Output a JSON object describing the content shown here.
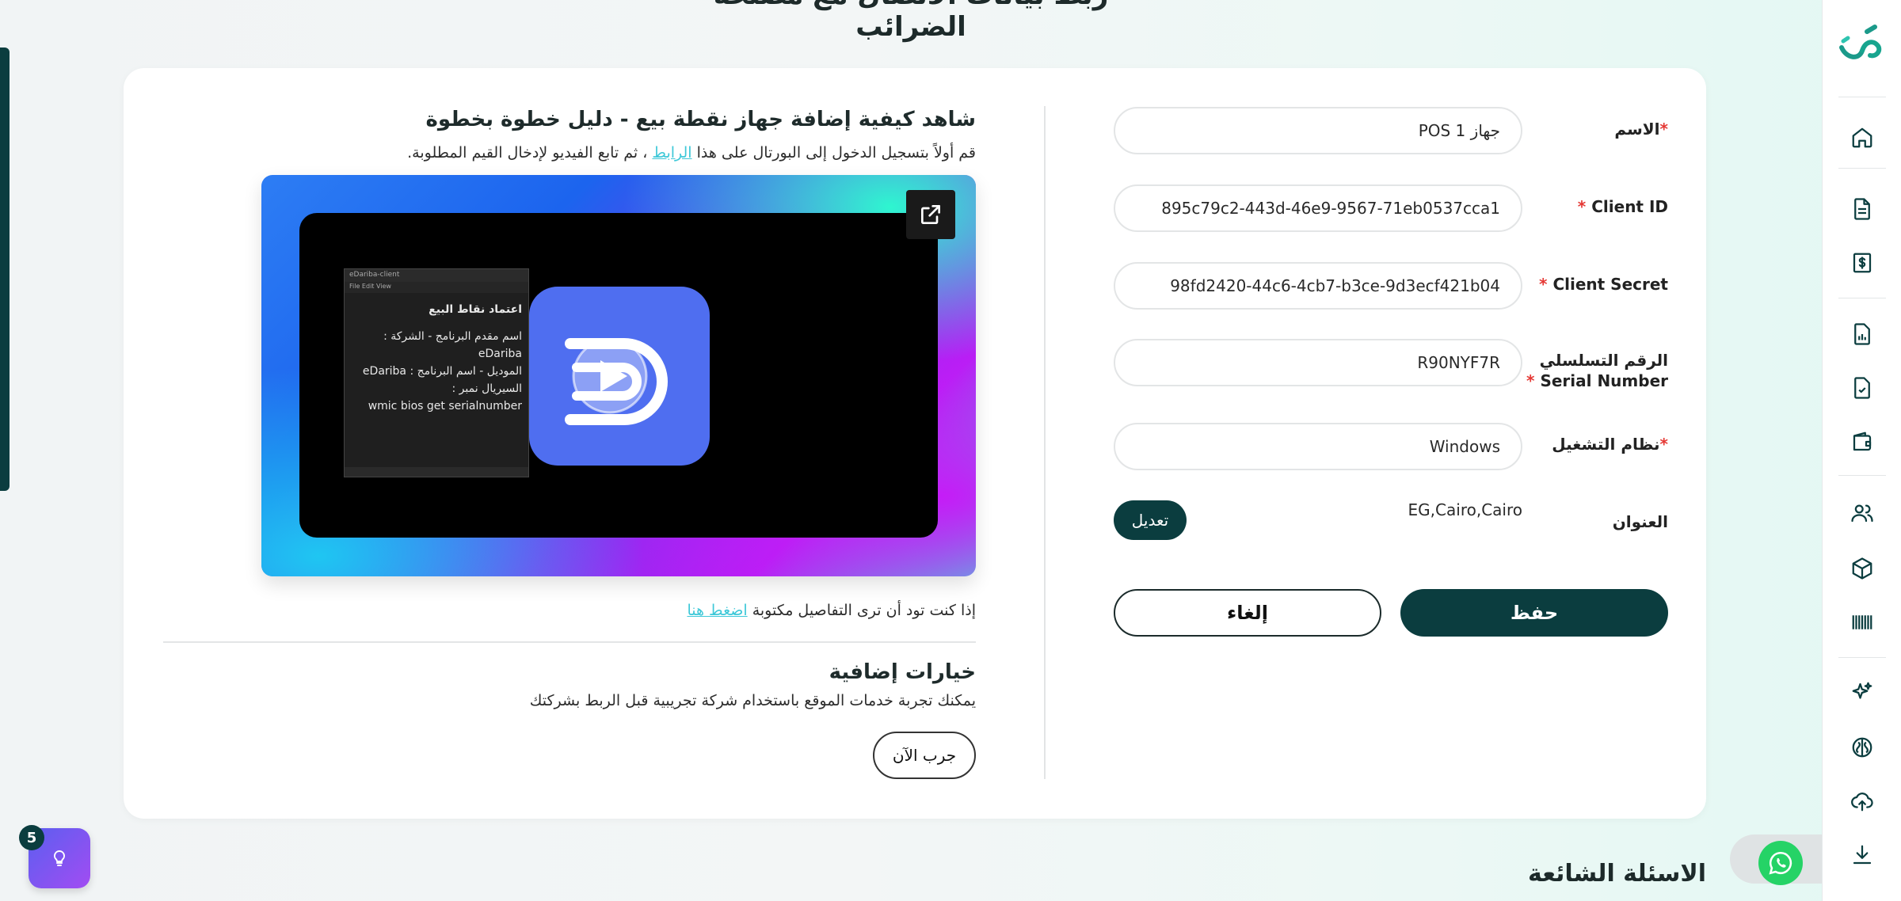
{
  "page": {
    "top_heading": "ربط بيانات الاتصال مع مصلحة الضرائب"
  },
  "form": {
    "name": {
      "label": "الاسم",
      "value": "جهاز POS 1"
    },
    "client_id": {
      "label": "Client ID",
      "value": "895c79c2-443d-46e9-9567-71eb0537cca1"
    },
    "client_secret": {
      "label": "Client Secret",
      "value": "98fd2420-44c6-4cb7-b3ce-9d3ecf421b04"
    },
    "serial": {
      "label_ar": "الرقم التسلسلي",
      "label_en": "Serial Number",
      "value": "R90NYF7R"
    },
    "os": {
      "label": "نظام التشغيل",
      "value": "Windows"
    },
    "address": {
      "label": "العنوان",
      "value": "EG,Cairo,Cairo",
      "edit_label": "تعديل"
    },
    "required_mark": "*",
    "save_label": "حفظ",
    "cancel_label": "إلغاء"
  },
  "guide": {
    "title": "شاهد كيفية إضافة جهاز نقطة بيع - دليل خطوة بخطوة",
    "sub_before": "قم أولاً بتسجيل الدخول إلى البورتال على هذا",
    "sub_link": "الرابط",
    "sub_after": "، ثم تابع الفيديو لإدخال القيم المطلوبة.",
    "written_before": "إذا كنت تود أن ترى التفاصيل مكتوبة",
    "written_link": "اضغط هنا",
    "video": {
      "window_title": "eDariba-client",
      "window_menu": "File   Edit   View",
      "lines": [
        "اعتماد نقاط البيع",
        "اسم مقدم البرنامج - الشركة : eDariba",
        "الموديل - اسم البرنامج : eDariba",
        "السيريال نمبر :",
        "wmic bios get serialnumber"
      ]
    }
  },
  "extra": {
    "title": "خيارات إضافية",
    "subtitle": "يمكنك تجربة خدمات الموقع باستخدام شركة تجريبية قبل الربط بشركتك",
    "try_label": "جرب الآن"
  },
  "faq": {
    "title": "الاسئلة الشائعة"
  },
  "widgets": {
    "help_badge": "5"
  },
  "sidebar": {
    "icons": [
      "logo-icon",
      "home-icon",
      "document-icon",
      "invoice-dollar-icon",
      "report-chart-icon",
      "document-check-icon",
      "wallet-icon",
      "users-icon",
      "package-box-icon",
      "barcode-icon",
      "sparkles-icon",
      "brain-icon",
      "cloud-upload-icon",
      "download-icon"
    ]
  },
  "colors": {
    "primary": "#0b3d3f",
    "link": "#3ec8d8",
    "required": "#e53935",
    "whatsapp": "#25d366"
  }
}
